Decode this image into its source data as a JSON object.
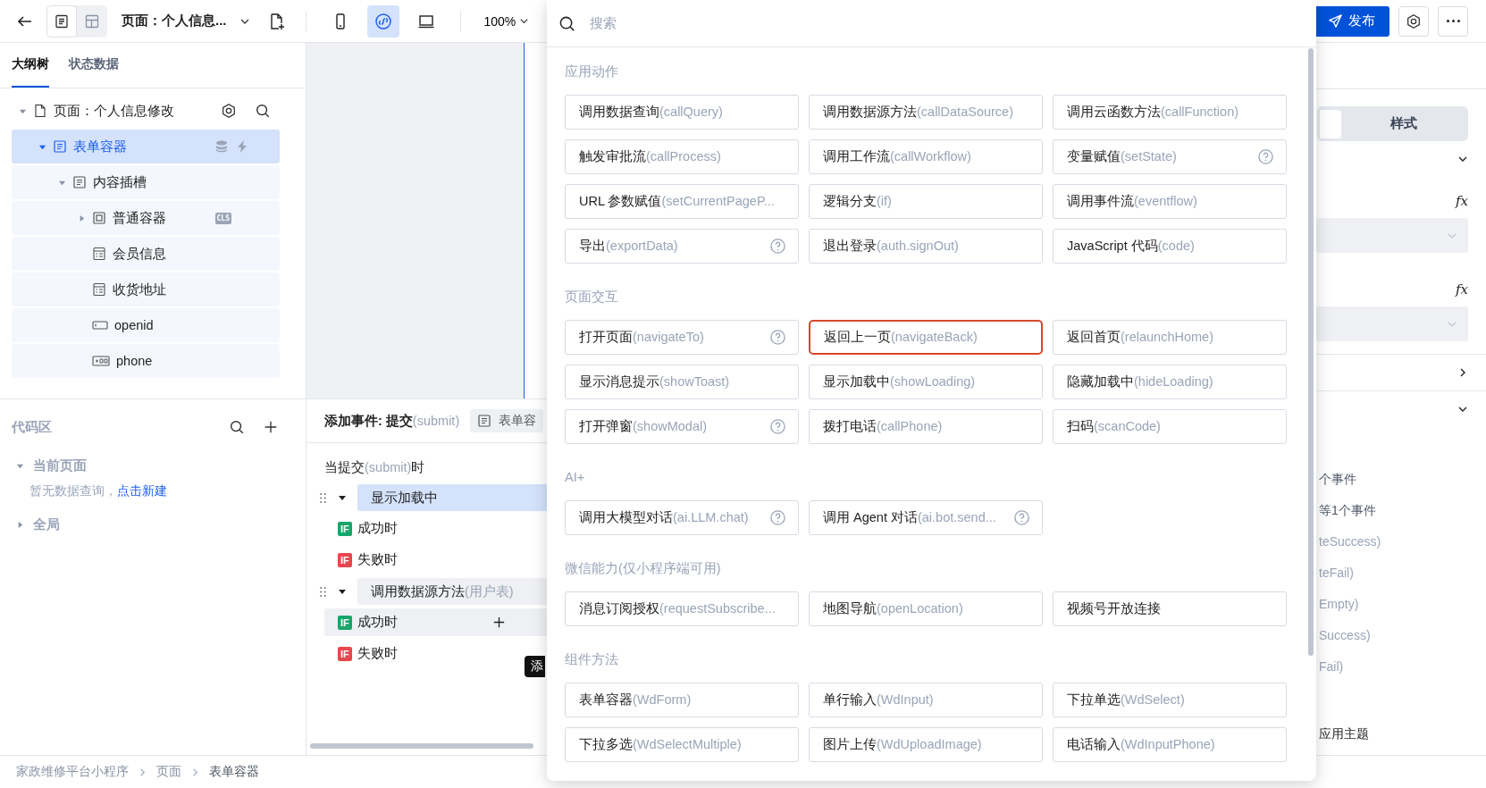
{
  "toolbar": {
    "page_title": "页面：个人信息...",
    "zoom": "100%",
    "publish": "发布",
    "views": [
      {
        "kind": "outline",
        "selected": true
      },
      {
        "kind": "layout",
        "selected": false
      }
    ],
    "devices": [
      {
        "kind": "phone",
        "selected": false
      },
      {
        "kind": "miniprogram",
        "selected": true
      },
      {
        "kind": "desktop",
        "selected": false
      }
    ]
  },
  "left_tabs": [
    {
      "label": "大纲树",
      "selected": true
    },
    {
      "label": "状态数据",
      "selected": false
    }
  ],
  "outline_tree": [
    {
      "label": "页面：个人信息修改",
      "kind": "page",
      "selected": false,
      "expanded": true,
      "children": [
        {
          "label": "表单容器",
          "kind": "form",
          "selected": true,
          "expanded": true,
          "children": [
            {
              "label": "内容插槽",
              "kind": "form",
              "selected": false,
              "expanded": true,
              "children": [
                {
                  "label": "普通容器",
                  "kind": "container",
                  "selected": false,
                  "expanded": false,
                  "badge": "CLS"
                },
                {
                  "label": "会员信息",
                  "kind": "table",
                  "selected": false
                },
                {
                  "label": "收货地址",
                  "kind": "table",
                  "selected": false
                },
                {
                  "label": "openid",
                  "kind": "input",
                  "selected": false
                },
                {
                  "label": "phone",
                  "kind": "phone",
                  "selected": false
                }
              ]
            }
          ]
        }
      ]
    }
  ],
  "code_area": {
    "title": "代码区",
    "groups": [
      {
        "label": "当前页面",
        "expanded": true,
        "empty_text": "暂无数据查询，",
        "link": "点击新建"
      },
      {
        "label": "全局",
        "expanded": false
      }
    ]
  },
  "event_panel": {
    "title": "添加事件: 提交",
    "event_code": "(submit)",
    "component_chip": "表单容",
    "trigger": {
      "prefix": "当提交",
      "code": "(submit)",
      "suffix": "时"
    },
    "actions": [
      {
        "label": "显示加载中",
        "selected": true,
        "expanded": true,
        "branches": [
          {
            "kind": "success",
            "tag": "IF",
            "label": "成功时",
            "hovered": false
          },
          {
            "kind": "fail",
            "tag": "IF",
            "label": "失败时",
            "hovered": false
          }
        ]
      },
      {
        "label": "调用数据源方法",
        "param": "(用户表)",
        "selected": false,
        "expanded": true,
        "branches": [
          {
            "kind": "success",
            "tag": "IF",
            "label": "成功时",
            "hovered": true
          },
          {
            "kind": "fail",
            "tag": "IF",
            "label": "失败时",
            "hovered": false
          }
        ]
      }
    ],
    "tooltip": "添"
  },
  "breadcrumb": [
    "家政维修平台小程序",
    "页面",
    "表单容器"
  ],
  "action_picker": {
    "search_placeholder": "搜索",
    "sections": [
      {
        "title": "应用动作",
        "items": [
          {
            "name": "调用数据查询",
            "method": "(callQuery)",
            "help": false,
            "highlighted": false
          },
          {
            "name": "调用数据源方法",
            "method": "(callDataSource)",
            "help": false,
            "highlighted": false
          },
          {
            "name": "调用云函数方法",
            "method": "(callFunction)",
            "help": false,
            "highlighted": false
          },
          {
            "name": "触发审批流",
            "method": "(callProcess)",
            "help": false,
            "highlighted": false
          },
          {
            "name": "调用工作流",
            "method": "(callWorkflow)",
            "help": false,
            "highlighted": false
          },
          {
            "name": "变量赋值",
            "method": "(setState)",
            "help": true,
            "highlighted": false
          },
          {
            "name": "URL 参数赋值",
            "method": "(setCurrentPageP...",
            "help": false,
            "highlighted": false
          },
          {
            "name": "逻辑分支",
            "method": "(if)",
            "help": false,
            "highlighted": false
          },
          {
            "name": "调用事件流",
            "method": "(eventflow)",
            "help": false,
            "highlighted": false
          },
          {
            "name": "导出",
            "method": "(exportData)",
            "help": true,
            "highlighted": false
          },
          {
            "name": "退出登录",
            "method": "(auth.signOut)",
            "help": false,
            "highlighted": false
          },
          {
            "name": "JavaScript 代码",
            "method": "(code)",
            "help": false,
            "highlighted": false
          }
        ]
      },
      {
        "title": "页面交互",
        "items": [
          {
            "name": "打开页面",
            "method": "(navigateTo)",
            "help": true,
            "highlighted": false
          },
          {
            "name": "返回上一页",
            "method": "(navigateBack)",
            "help": false,
            "highlighted": true
          },
          {
            "name": "返回首页",
            "method": "(relaunchHome)",
            "help": false,
            "highlighted": false
          },
          {
            "name": "显示消息提示",
            "method": "(showToast)",
            "help": false,
            "highlighted": false
          },
          {
            "name": "显示加载中",
            "method": "(showLoading)",
            "help": false,
            "highlighted": false
          },
          {
            "name": "隐藏加载中",
            "method": "(hideLoading)",
            "help": false,
            "highlighted": false
          },
          {
            "name": "打开弹窗",
            "method": "(showModal)",
            "help": true,
            "highlighted": false
          },
          {
            "name": "拨打电话",
            "method": "(callPhone)",
            "help": false,
            "highlighted": false
          },
          {
            "name": "扫码",
            "method": "(scanCode)",
            "help": false,
            "highlighted": false
          }
        ]
      },
      {
        "title": "AI+",
        "items": [
          {
            "name": "调用大模型对话",
            "method": "(ai.LLM.chat)",
            "help": true,
            "highlighted": false
          },
          {
            "name": "调用 Agent 对话",
            "method": "(ai.bot.send...",
            "help": true,
            "highlighted": false
          }
        ]
      },
      {
        "title": "微信能力(仅小程序端可用)",
        "items": [
          {
            "name": "消息订阅授权",
            "method": "(requestSubscribe...",
            "help": false,
            "highlighted": false
          },
          {
            "name": "地图导航",
            "method": "(openLocation)",
            "help": false,
            "highlighted": false
          },
          {
            "name": "视频号开放连接",
            "help": false,
            "highlighted": false
          }
        ]
      },
      {
        "title": "组件方法",
        "items": [
          {
            "name": "表单容器",
            "method": "(WdForm)",
            "help": false,
            "highlighted": false
          },
          {
            "name": "单行输入",
            "method": "(WdInput)",
            "help": false,
            "highlighted": false
          },
          {
            "name": "下拉单选",
            "method": "(WdSelect)",
            "help": false,
            "highlighted": false
          },
          {
            "name": "下拉多选",
            "method": "(WdSelectMultiple)",
            "help": false,
            "highlighted": false
          },
          {
            "name": "图片上传",
            "method": "(WdUploadImage)",
            "help": false,
            "highlighted": false
          },
          {
            "name": "电话输入",
            "method": "(WdInputPhone)",
            "help": false,
            "highlighted": false
          }
        ]
      }
    ]
  },
  "right_panel": {
    "tab": {
      "label": "样式",
      "selected": false
    },
    "groups": [
      {
        "expanded": true,
        "fields": [
          {
            "kind": "formula_select",
            "fx": "fx"
          },
          {
            "kind": "formula_select",
            "fx": "fx"
          }
        ]
      },
      {
        "expanded": false
      },
      {
        "expanded": true,
        "lines": [
          {
            "kind": "count",
            "text": "个事件"
          },
          {
            "kind": "count",
            "text": "等1个事件"
          },
          {
            "kind": "code",
            "text": "teSuccess)"
          },
          {
            "kind": "code",
            "text": "teFail)"
          },
          {
            "kind": "code",
            "text": "Empty)"
          },
          {
            "kind": "code",
            "text": "Success)"
          },
          {
            "kind": "code",
            "text": "Fail)"
          }
        ]
      }
    ],
    "theme_label": "应用主题"
  }
}
